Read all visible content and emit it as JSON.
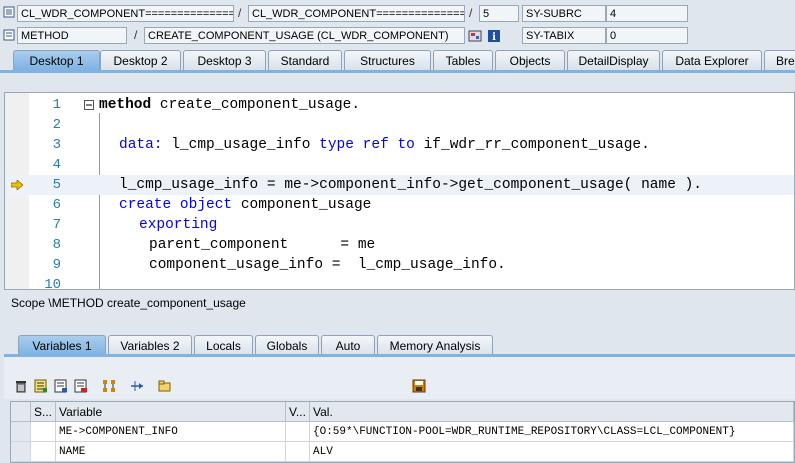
{
  "header": {
    "row1": {
      "field1": "CL_WDR_COMPONENT===============",
      "field2": "CL_WDR_COMPONENT===============",
      "line": "5",
      "sysvar": "SY-SUBRC",
      "sysval": "4"
    },
    "row2": {
      "field1": "METHOD",
      "field2": "CREATE_COMPONENT_USAGE (CL_WDR_COMPONENT)",
      "sysvar": "SY-TABIX",
      "sysval": "0"
    },
    "separator": "/"
  },
  "tabs": [
    "Desktop 1",
    "Desktop 2",
    "Desktop 3",
    "Standard",
    "Structures",
    "Tables",
    "Objects",
    "DetailDisplay",
    "Data Explorer",
    "Bre"
  ],
  "editor": {
    "lines": [
      {
        "num": "1",
        "text": "method create_component_usage."
      },
      {
        "num": "2",
        "text": ""
      },
      {
        "num": "3",
        "text": "data: l_cmp_usage_info type ref to if_wdr_rr_component_usage."
      },
      {
        "num": "4",
        "text": ""
      },
      {
        "num": "5",
        "text": "l_cmp_usage_info = me->component_info->get_component_usage( name )."
      },
      {
        "num": "6",
        "text": "create object component_usage"
      },
      {
        "num": "7",
        "text": "exporting"
      },
      {
        "num": "8",
        "text": "parent_component      = me"
      },
      {
        "num": "9",
        "text": "component_usage_info =  l_cmp_usage_info."
      },
      {
        "num": "10",
        "text": ""
      }
    ],
    "current_line": "5"
  },
  "scope": "Scope \\METHOD create_component_usage",
  "lower_tabs": [
    "Variables 1",
    "Variables 2",
    "Locals",
    "Globals",
    "Auto",
    "Memory Analysis"
  ],
  "grid": {
    "headers": [
      "S...",
      "Variable",
      "V...",
      "Val."
    ],
    "rows": [
      {
        "variable": "ME->COMPONENT_INFO",
        "value": "{O:59*\\FUNCTION-POOL=WDR_RUNTIME_REPOSITORY\\CLASS=LCL_COMPONENT}"
      },
      {
        "variable": "NAME",
        "value": "ALV"
      }
    ]
  },
  "colors": {
    "active_tab": "#7fb3e3",
    "keyword": "#0000ff",
    "line_number": "#2d7da6",
    "breakpoint_arrow": "#e8c000"
  }
}
